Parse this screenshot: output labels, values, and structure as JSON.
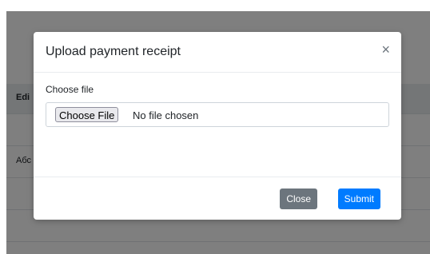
{
  "background": {
    "table_header_text": "Edi",
    "row_text": "Абс"
  },
  "modal": {
    "title": "Upload payment receipt",
    "close_glyph": "×",
    "field_label": "Choose file",
    "file_button": "Choose File",
    "file_status": "No file chosen",
    "footer_buttons": {
      "close": "Close",
      "submit": "Submit"
    }
  },
  "colors": {
    "overlay": "rgba(0,0,0,0.5)",
    "primary": "#007bff",
    "secondary": "#6c757d"
  }
}
